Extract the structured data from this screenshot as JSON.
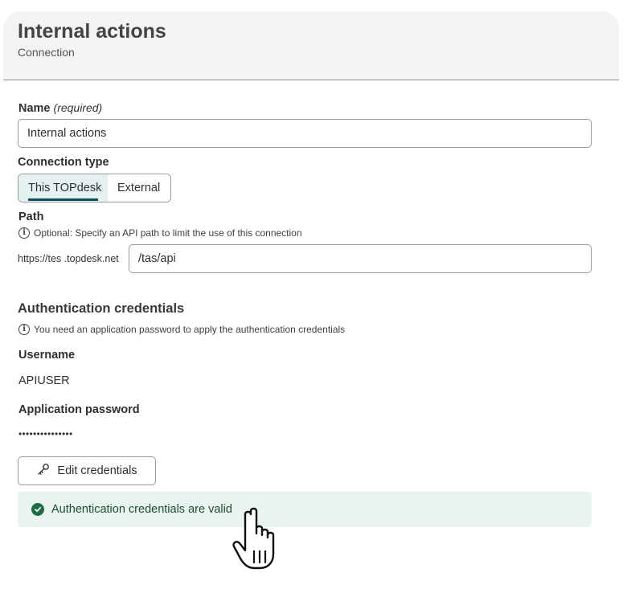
{
  "header": {
    "title": "Internal actions",
    "subtitle": "Connection"
  },
  "form": {
    "name": {
      "label": "Name",
      "required_label": "(required)",
      "value": "Internal actions"
    },
    "connection_type": {
      "label": "Connection type",
      "options": [
        "This TOPdesk",
        "External"
      ],
      "selected": "This TOPdesk"
    },
    "path": {
      "label": "Path",
      "hint": "Optional: Specify an API path to limit the use of this connection",
      "prefix": "https://tes .topdesk.net",
      "value": "/tas/api"
    }
  },
  "auth": {
    "section_title": "Authentication credentials",
    "hint": "You need an application password to apply the authentication credentials",
    "username_label": "Username",
    "username_value": "APIUSER",
    "password_label": "Application password",
    "password_value": "•••••••••••••••",
    "edit_button_label": "Edit credentials",
    "status_message": "Authentication credentials are valid",
    "status_color": "#1f6b45"
  },
  "icons": {
    "info": "info-icon",
    "key": "key-icon",
    "success": "check-circle-icon",
    "cursor": "hand-pointer-cursor"
  }
}
